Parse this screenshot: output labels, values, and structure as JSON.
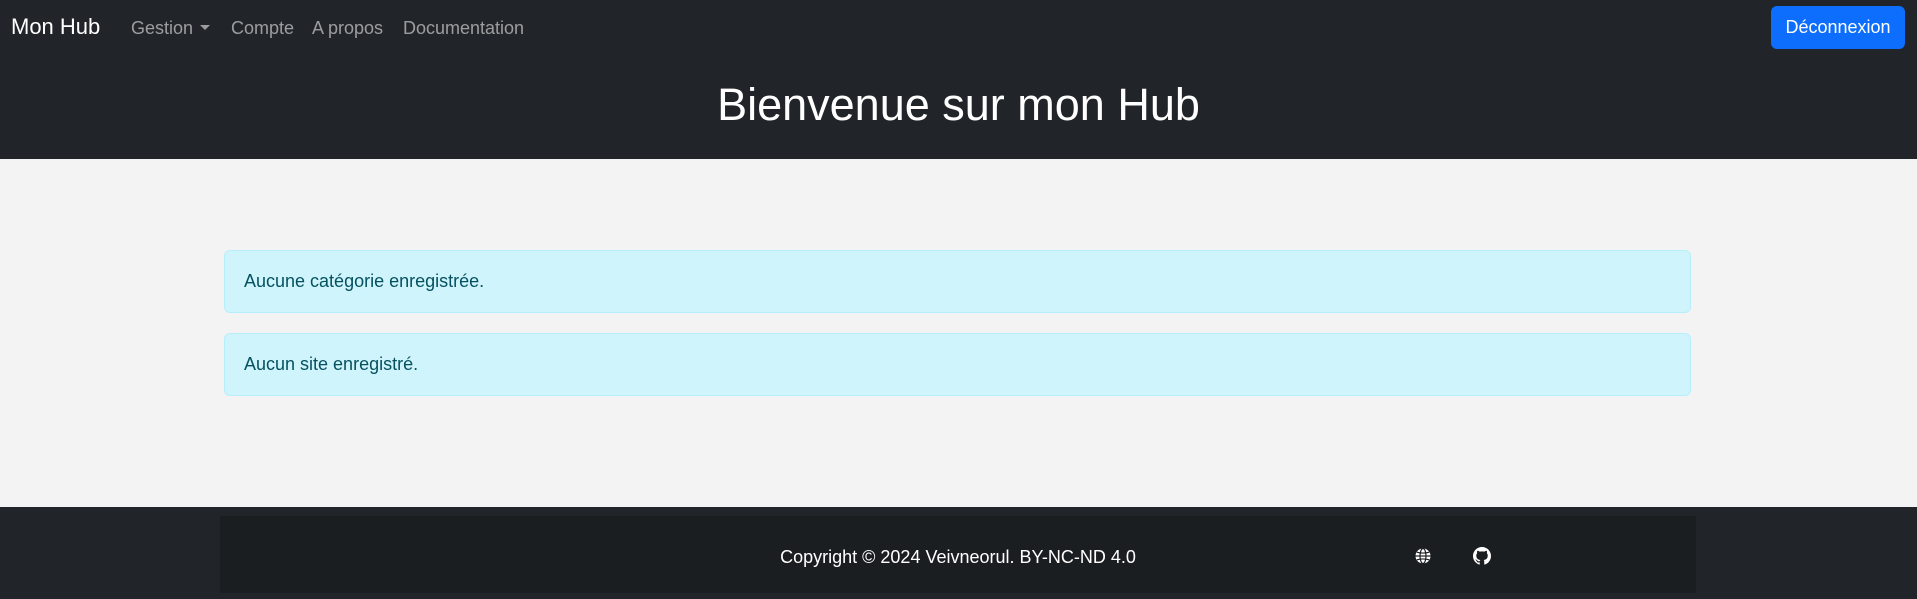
{
  "navbar": {
    "brand": "Mon Hub",
    "items": [
      {
        "label": "Gestion",
        "dropdown": true
      },
      {
        "label": "Compte"
      },
      {
        "label": "A propos"
      },
      {
        "label": "Documentation"
      }
    ],
    "logout_label": "Déconnexion"
  },
  "header": {
    "title": "Bienvenue sur mon Hub"
  },
  "main": {
    "alerts": [
      {
        "text": "Aucune catégorie enregistrée."
      },
      {
        "text": "Aucun site enregistré."
      }
    ]
  },
  "footer": {
    "copyright": "Copyright © 2024 Veivneorul. BY-NC-ND 4.0",
    "icons": [
      "globe-icon",
      "github-icon"
    ]
  },
  "colors": {
    "navbar_bg": "#212529",
    "primary": "#0d6efd",
    "alert_bg": "#cff4fc",
    "alert_text": "#055160",
    "page_bg": "#f3f3f3"
  }
}
